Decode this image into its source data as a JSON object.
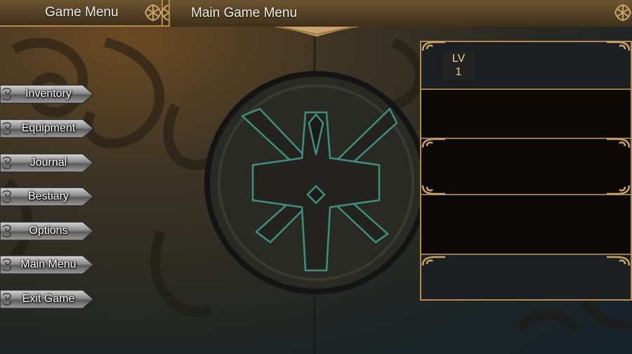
{
  "header": {
    "left_tab_label": "Game Menu",
    "title": "Main Game Menu"
  },
  "menu": {
    "items": [
      {
        "label": "Inventory",
        "name": "menu-button-inventory"
      },
      {
        "label": "Equipment",
        "name": "menu-button-equipment"
      },
      {
        "label": "Journal",
        "name": "menu-button-journal"
      },
      {
        "label": "Bestiary",
        "name": "menu-button-bestiary"
      },
      {
        "label": "Options",
        "name": "menu-button-options"
      },
      {
        "label": "Main Menu",
        "name": "menu-button-main-menu"
      },
      {
        "label": "Exit Game",
        "name": "menu-button-exit-game"
      }
    ]
  },
  "party_panel": {
    "level_label": "LV",
    "level_value": "1"
  },
  "colors": {
    "gold_border": "#b48a4e",
    "level_text": "#e9cf86",
    "crest_glow": "#3f8f80"
  }
}
